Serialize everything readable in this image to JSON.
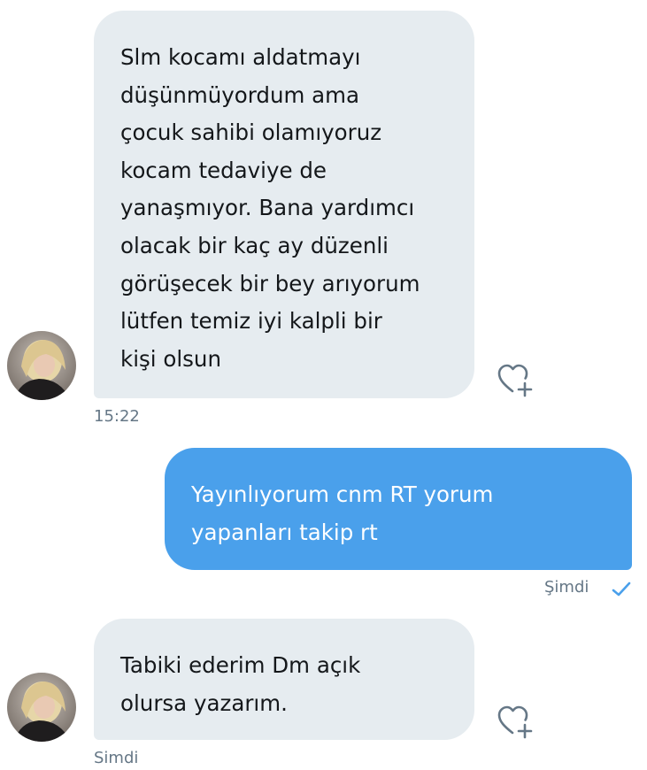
{
  "messages": [
    {
      "direction": "incoming",
      "lines": [
        "Slm kocamı aldatmayı",
        "düşünmüyordum ama",
        "çocuk sahibi olamıyoruz",
        "kocam tedaviye de",
        "yanaşmıyor. Bana yardımcı",
        "olacak bir kaç ay düzenli",
        "görüşecek bir bey arıyorum",
        "lütfen temiz iyi kalpli bir",
        "kişi olsun"
      ],
      "timestamp": "15:22",
      "avatar_icon": "profile-photo",
      "like_icon": "heart-plus-icon"
    },
    {
      "direction": "outgoing",
      "lines": [
        "Yayınlıyorum cnm RT yorum",
        "yapanları takip rt"
      ],
      "timestamp": "Şimdi",
      "status_icon": "checkmark-icon"
    },
    {
      "direction": "incoming",
      "lines": [
        "Tabiki ederim Dm açık",
        "olursa yazarım."
      ],
      "timestamp": "Simdi",
      "avatar_icon": "profile-photo",
      "like_icon": "heart-plus-icon"
    }
  ],
  "colors": {
    "incoming_bubble": "#e6ecf0",
    "outgoing_bubble": "#4aa0eb",
    "timestamp": "#657786",
    "check": "#4aa0eb"
  }
}
